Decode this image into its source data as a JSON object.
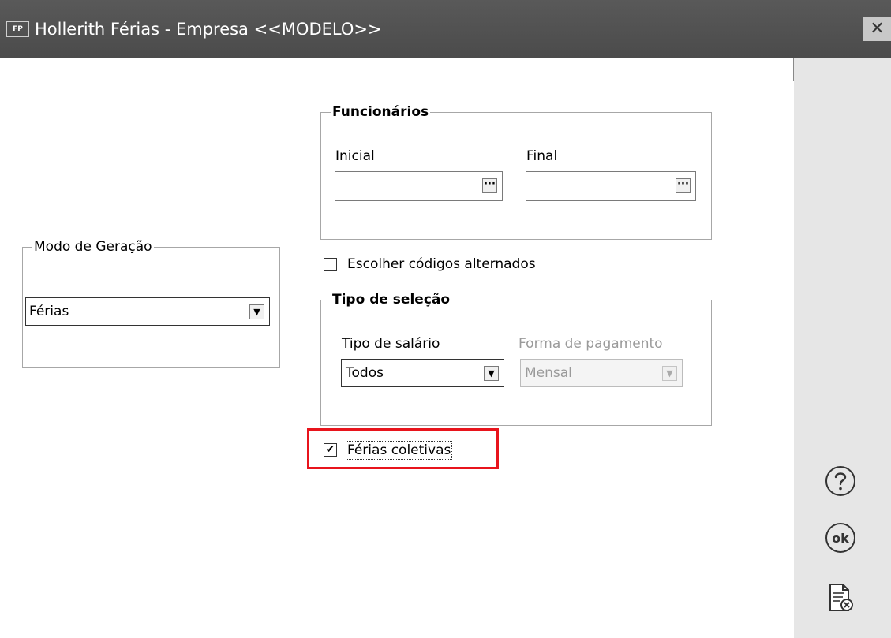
{
  "window": {
    "app_badge": "FP",
    "title": "Hollerith Férias - Empresa <<MODELO>>",
    "close_icon": "close-icon"
  },
  "modo_geracao": {
    "legend": "Modo de Geração",
    "selected": "Férias"
  },
  "funcionarios": {
    "legend": "Funcionários",
    "inicial_label": "Inicial",
    "inicial_value": "",
    "final_label": "Final",
    "final_value": "",
    "lookup_glyph": "···"
  },
  "escolher_codigos": {
    "label": "Escolher códigos alternados",
    "checked": false
  },
  "tipo_selecao": {
    "legend": "Tipo de seleção",
    "tipo_salario_label": "Tipo de salário",
    "tipo_salario_value": "Todos",
    "forma_pagamento_label": "Forma de pagamento",
    "forma_pagamento_value": "Mensal"
  },
  "ferias_coletivas": {
    "label": "Férias coletivas",
    "checked": true,
    "check_glyph": "✔"
  },
  "highlight_color": "#e8141c",
  "side_icons": [
    "help-icon",
    "ok-icon",
    "cancel-report-icon"
  ]
}
